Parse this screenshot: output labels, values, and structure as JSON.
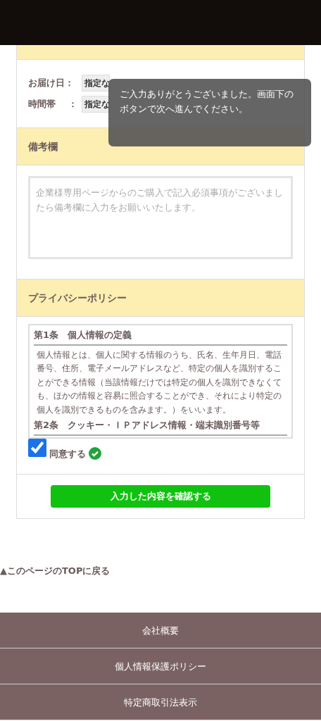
{
  "delivery": [
    {
      "label": "お届け日",
      "colon": "：",
      "value": "指定な"
    },
    {
      "label": "時間帯",
      "colon": "：",
      "value": "指定な"
    }
  ],
  "remarks": {
    "title": "備考欄",
    "placeholder": "企業様専用ページからのご購入で記入必須事項がございましたら備考欄に入力をお願いいたします。"
  },
  "privacy": {
    "title": "プライバシーポリシー",
    "sections": [
      {
        "heading": "第1条　個人情報の定義",
        "body": "個人情報とは、個人に関する情報のうち、氏名、生年月日、電話番号、住所、電子メールアドレスなど、特定の個人を識別することができる情報（当該情報だけでは特定の個人を識別できなくても、ほかの情報と容易に照合することができ、それにより特定の個人を識別できるものを含みます。）をいいます。"
      },
      {
        "heading": "第2条　クッキー・ＩＰアドレス情報・端末識別番号等"
      }
    ],
    "agree": {
      "label": "同意する",
      "checked": true,
      "valid": true
    }
  },
  "confirm_button": "入力した内容を確認する",
  "back_to_top": "▲このページのTOPに戻る",
  "footer_links": [
    "会社概要",
    "個人情報保護ポリシー",
    "特定商取引法表示"
  ],
  "toast": "ご入力ありがとうございました。画面下のボタンで次へ進んでください。"
}
